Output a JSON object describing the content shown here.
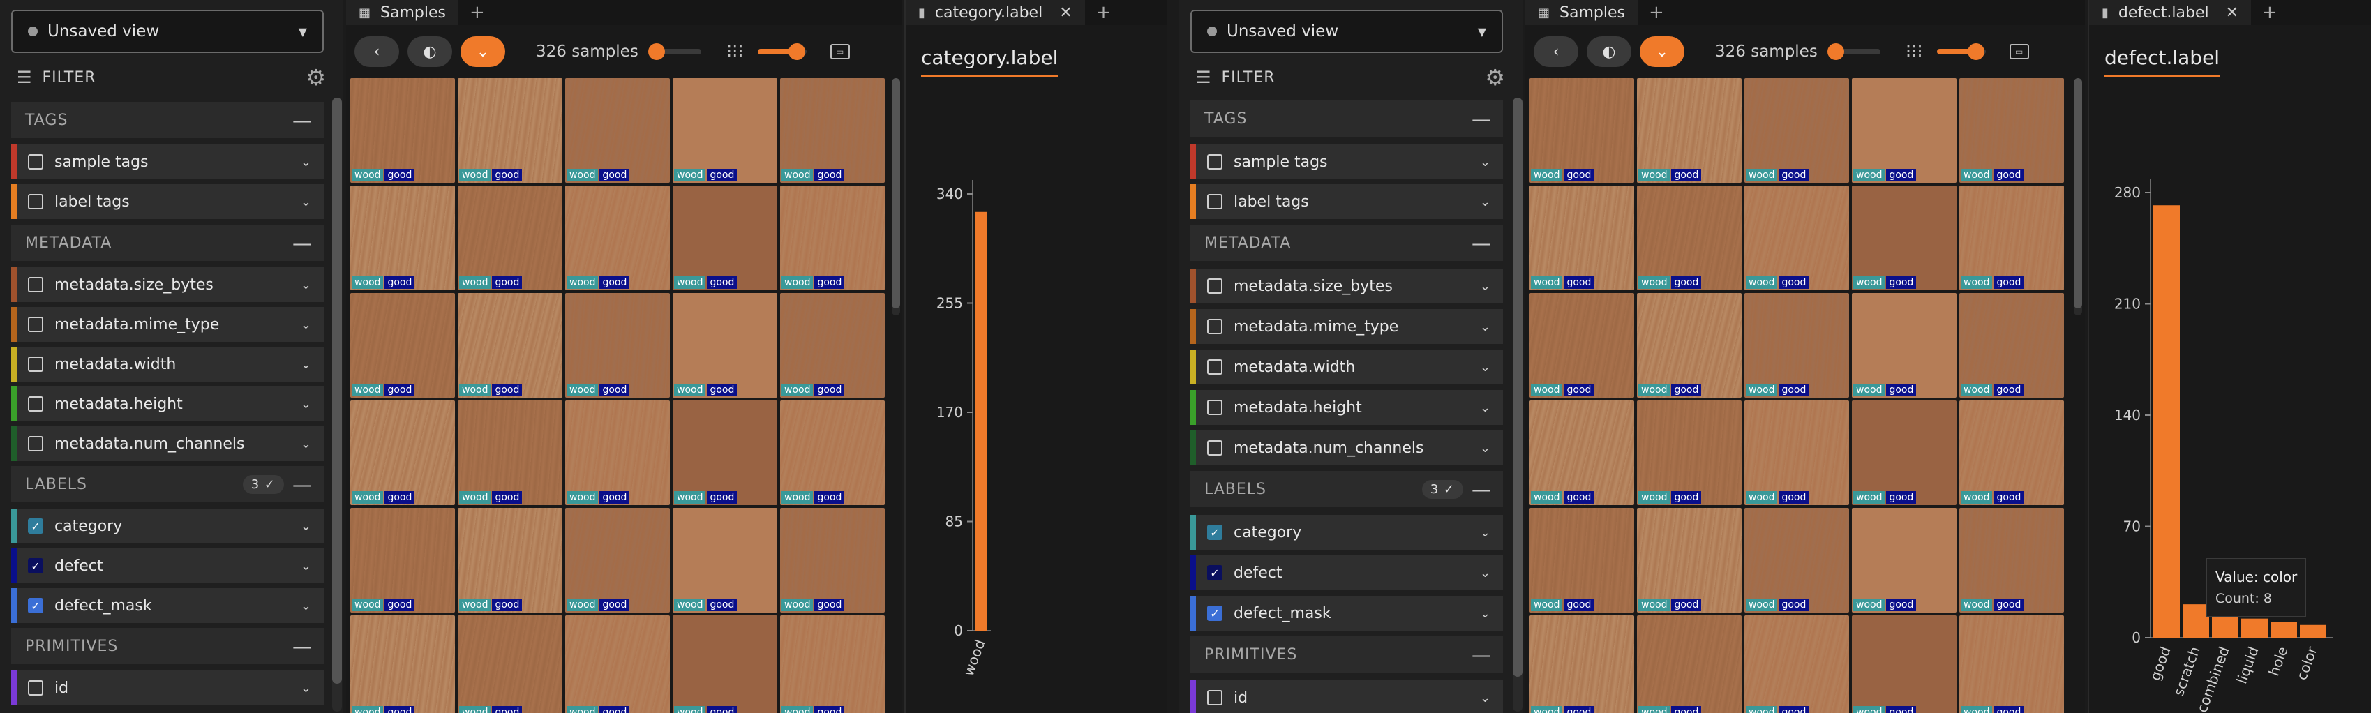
{
  "left": {
    "view_select": "Unsaved view",
    "filter_label": "FILTER",
    "sections": {
      "tags": "TAGS",
      "metadata": "METADATA",
      "labels": "LABELS",
      "labels_badge": "3 ✓",
      "primitives": "PRIMITIVES"
    },
    "fields": {
      "sample_tags": "sample tags",
      "label_tags": "label tags",
      "size_bytes": "metadata.size_bytes",
      "mime_type": "metadata.mime_type",
      "width": "metadata.width",
      "height": "metadata.height",
      "num_channels": "metadata.num_channels",
      "category": "category",
      "defect": "defect",
      "defect_mask": "defect_mask",
      "id": "id"
    },
    "tabs": {
      "samples": "Samples",
      "hist": "category.label"
    },
    "sample_count": "326 samples",
    "thumb_tags": [
      "wood",
      "good"
    ],
    "hist_title": "category.label"
  },
  "right": {
    "view_select": "Unsaved view",
    "filter_label": "FILTER",
    "sections": {
      "tags": "TAGS",
      "metadata": "METADATA",
      "labels": "LABELS",
      "labels_badge": "3 ✓",
      "primitives": "PRIMITIVES"
    },
    "fields": {
      "sample_tags": "sample tags",
      "label_tags": "label tags",
      "size_bytes": "metadata.size_bytes",
      "mime_type": "metadata.mime_type",
      "width": "metadata.width",
      "height": "metadata.height",
      "num_channels": "metadata.num_channels",
      "category": "category",
      "defect": "defect",
      "defect_mask": "defect_mask",
      "id": "id"
    },
    "tabs": {
      "samples": "Samples",
      "hist": "defect.label"
    },
    "sample_count": "326 samples",
    "thumb_tags": [
      "wood",
      "good"
    ],
    "hist_title": "defect.label",
    "tooltip": {
      "value": "Value: color",
      "count": "Count: 8"
    }
  },
  "colors": {
    "accent": "#f07a2a",
    "wood_tag": "#3a9999",
    "good_tag": "#0a0f8a",
    "field_bars": {
      "sample_tags": "#c0392b",
      "label_tags": "#e67e22",
      "size_bytes": "#a0522d",
      "mime_type": "#b5651d",
      "width": "#c9b024",
      "height": "#3aa02a",
      "num_channels": "#1f5e2a",
      "category": "#3a9999",
      "defect": "#0a0f8a",
      "defect_mask": "#3b6fd6",
      "id": "#7a3ad6"
    }
  },
  "chart_data": [
    {
      "type": "bar",
      "categories": [
        "wood"
      ],
      "values": [
        326
      ],
      "y_ticks": [
        0,
        85,
        170,
        255,
        340
      ],
      "ylim": [
        0,
        340
      ]
    },
    {
      "type": "bar",
      "categories": [
        "good",
        "scratch",
        "combined",
        "liquid",
        "hole",
        "color"
      ],
      "values": [
        272,
        21,
        18,
        12,
        10,
        8
      ],
      "y_ticks": [
        0,
        70,
        140,
        210,
        280
      ],
      "ylim": [
        0,
        280
      ]
    }
  ]
}
